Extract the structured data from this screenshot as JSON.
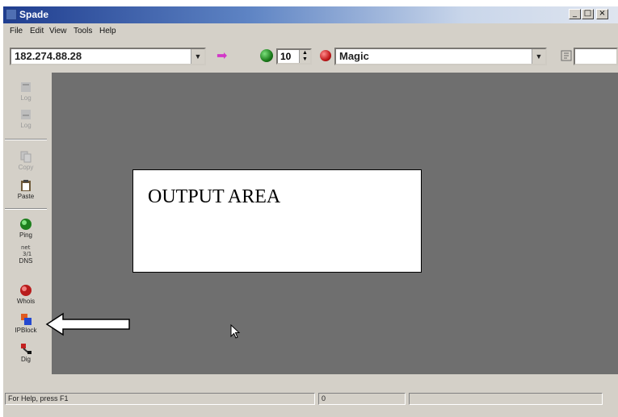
{
  "window": {
    "title": "Spade",
    "buttons": {
      "minimize": "_",
      "maximize": "□",
      "close": "×"
    }
  },
  "menu": [
    "File",
    "Edit",
    "View",
    "Tools",
    "Help"
  ],
  "toolbar": {
    "address_value": "182.274.88.28",
    "dropdown_glyph": "▼",
    "go_arrow": "➡",
    "spin_value": "10",
    "spin_up": "▲",
    "spin_down": "▼",
    "mode_value": "Magic"
  },
  "palette": {
    "tools": [
      {
        "label": "Log",
        "icon": "log-icon",
        "enabled": false
      },
      {
        "label": "Log",
        "icon": "log-icon",
        "enabled": false
      },
      {
        "label": "Copy",
        "icon": "copy-icon",
        "enabled": false
      },
      {
        "label": "Paste",
        "icon": "paste-icon",
        "enabled": true
      },
      {
        "label": "Ping",
        "icon": "ping-icon",
        "enabled": true
      },
      {
        "label": "DNS",
        "icon": "dns-icon",
        "enabled": true
      },
      {
        "label": "Whois",
        "icon": "whois-icon",
        "enabled": true
      },
      {
        "label": "IPBlock",
        "icon": "ipblock-icon",
        "enabled": true
      },
      {
        "label": "Dig",
        "icon": "dig-icon",
        "enabled": true
      }
    ],
    "dns_top_text": "net\n3/1"
  },
  "output": {
    "annotation_label": "OUTPUT AREA",
    "background_color": "#6f6f6f"
  },
  "statusbar": {
    "help_text": "For Help, press F1",
    "counter": "0",
    "extra": ""
  },
  "colors": {
    "title_gradient_start": "#1f3d8f",
    "face": "#d4d0c8",
    "go_arrow": "#d238c8"
  }
}
